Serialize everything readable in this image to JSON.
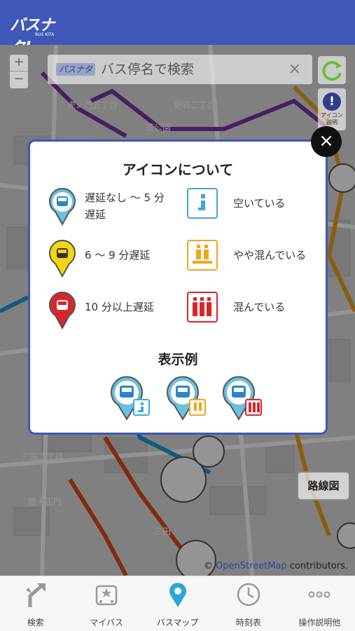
{
  "app": {
    "logo_text": "バスナタ!",
    "logo_sub": "BUS KITA"
  },
  "map": {
    "zoom_in": "+",
    "zoom_out": "−",
    "search": {
      "logo": "バスナタ",
      "placeholder": "バス停名で検索",
      "clear": "×"
    },
    "icon_button_label": "アイコン 説明",
    "route_button": "路線図",
    "attribution_prefix": "© ",
    "attribution_link": "OpenStreetMap",
    "attribution_suffix": " contributors.",
    "labels": [
      "虎ノ門五丁目",
      "愛宕二丁目",
      "芝公園",
      "三田二丁目",
      "慶大正門",
      "三田"
    ]
  },
  "modal": {
    "title": "アイコンについて",
    "legend": [
      {
        "label": "遅延なし ～ 5 分\n遅延",
        "color": "#6bbfe0"
      },
      {
        "label": "6 ～ 9 分遅延",
        "color": "#f2d70f"
      },
      {
        "label": "10 分以上遅延",
        "color": "#d8262d"
      },
      {
        "label": "空いている",
        "color": "#3fa9d6"
      },
      {
        "label": "やや混んでいる",
        "color": "#f0a51e"
      },
      {
        "label": "混んでいる",
        "color": "#d8262d"
      }
    ],
    "example_title": "表示例",
    "close": "×"
  },
  "nav": {
    "items": [
      {
        "label": "検索",
        "icon": "route-arrow-icon"
      },
      {
        "label": "マイバス",
        "icon": "bus-star-icon"
      },
      {
        "label": "バスマップ",
        "icon": "map-pin-icon",
        "active": true
      },
      {
        "label": "時刻表",
        "icon": "clock-icon"
      },
      {
        "label": "操作説明他",
        "icon": "more-icon"
      }
    ]
  },
  "colors": {
    "header": "#3f57b8",
    "active": "#2aa7d8"
  }
}
